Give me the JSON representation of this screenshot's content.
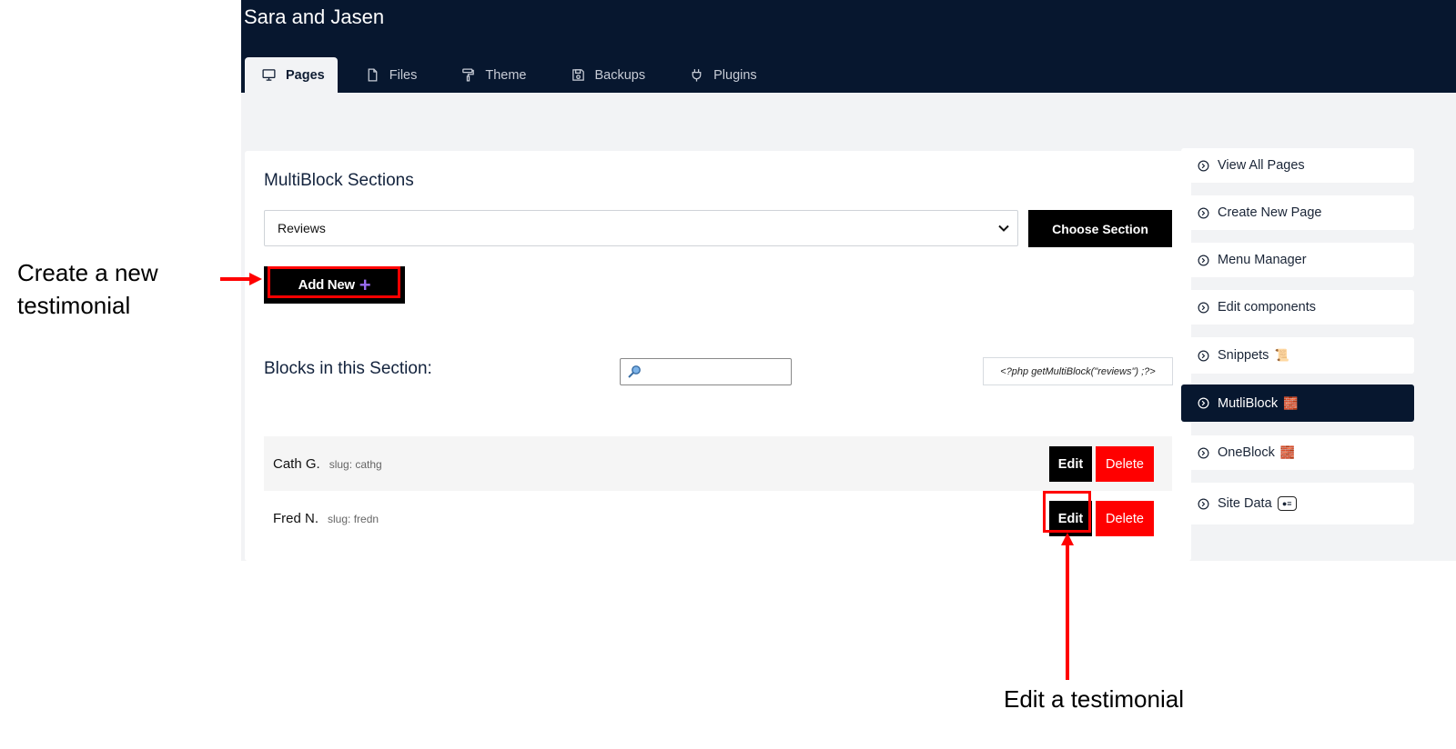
{
  "header": {
    "site_title": "Sara and Jasen",
    "tabs": [
      {
        "label": "Pages",
        "icon": "monitor-icon",
        "active": true
      },
      {
        "label": "Files",
        "icon": "file-icon",
        "active": false
      },
      {
        "label": "Theme",
        "icon": "paint-roller-icon",
        "active": false
      },
      {
        "label": "Backups",
        "icon": "floppy-disk-icon",
        "active": false
      },
      {
        "label": "Plugins",
        "icon": "plug-icon",
        "active": false
      }
    ]
  },
  "main": {
    "title": "MultiBlock Sections",
    "section_select": {
      "value": "Reviews"
    },
    "choose_label": "Choose Section",
    "add_new_label": "Add New",
    "add_new_plus": "+",
    "blocks_label": "Blocks in this Section:",
    "search": {
      "placeholder": ""
    },
    "code_snippet": "<?php getMultiBlock(\"reviews\") ;?>",
    "rows": [
      {
        "name": "Cath G.",
        "slug": "slug: cathg",
        "edit": "Edit",
        "delete": "Delete"
      },
      {
        "name": "Fred N.",
        "slug": "slug: fredn",
        "edit": "Edit",
        "delete": "Delete"
      }
    ]
  },
  "sidebar": {
    "items": [
      {
        "label": "View All Pages",
        "emoji": ""
      },
      {
        "label": "Create New Page",
        "emoji": ""
      },
      {
        "label": "Menu Manager",
        "emoji": ""
      },
      {
        "label": "Edit components",
        "emoji": ""
      },
      {
        "label": "Snippets",
        "emoji": "📜"
      },
      {
        "label": "MutliBlock",
        "emoji": "🧱",
        "active": true
      },
      {
        "label": "OneBlock",
        "emoji": "🧱"
      },
      {
        "label": "Site Data",
        "emoji": ""
      }
    ]
  },
  "annotations": {
    "create": "Create a new testimonial",
    "edit": "Edit a testimonial"
  },
  "colors": {
    "header_bg": "#07172f",
    "highlight": "#ff0000",
    "delete_bg": "#ff0000",
    "button_bg": "#000000",
    "plus_color": "#9b6cf0"
  }
}
